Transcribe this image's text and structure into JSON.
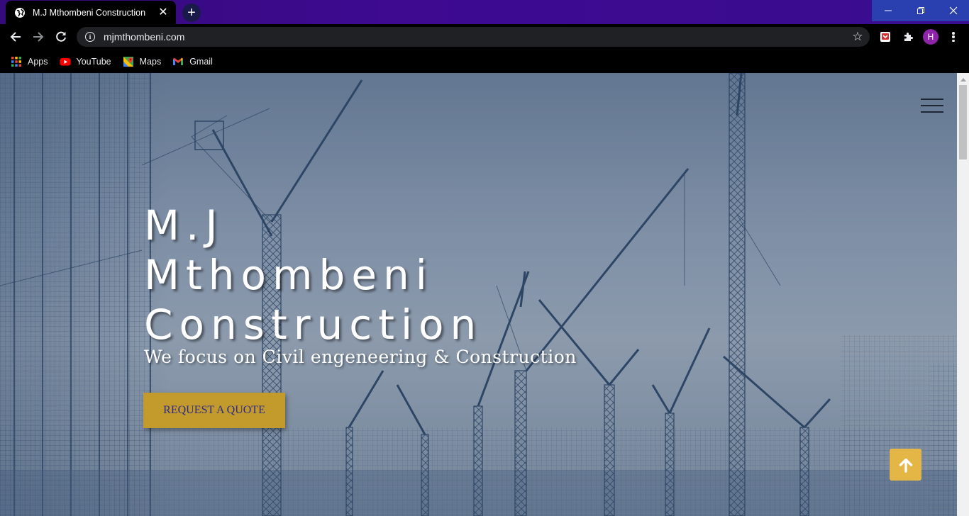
{
  "browser": {
    "tab": {
      "title": "M.J Mthombeni Construction",
      "close": "✕"
    },
    "new_tab": "+",
    "window_controls": {
      "minimize": "—",
      "maximize": "❐",
      "close": "✕"
    },
    "address": {
      "url": "mjmthombeni.com"
    },
    "profile_initial": "H",
    "bookmarks": [
      {
        "label": "Apps",
        "icon": "apps-grid-icon"
      },
      {
        "label": "YouTube",
        "icon": "youtube-icon"
      },
      {
        "label": "Maps",
        "icon": "maps-icon"
      },
      {
        "label": "Gmail",
        "icon": "gmail-icon"
      }
    ]
  },
  "hero": {
    "title_lines": [
      "M.J",
      "Mthombeni",
      "Construction"
    ],
    "subtitle": "We focus on Civil engeneering & Construction",
    "cta_label": "REQUEST A QUOTE"
  },
  "colors": {
    "tabstrip": "#3d0a90",
    "cta_background": "#c39a2c",
    "cta_text": "#2b2a8a",
    "back_to_top": "#e4b646",
    "avatar": "#8e24aa"
  }
}
